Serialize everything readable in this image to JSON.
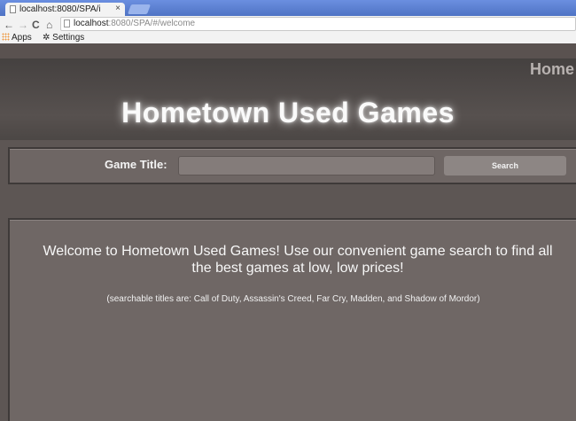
{
  "browser": {
    "tab_title": "localhost:8080/SPA/i",
    "tab_close": "×",
    "url_host": "localhost",
    "url_path": ":8080/SPA/#/welcome",
    "bookmarks": {
      "apps": "Apps",
      "settings_icon": "✲",
      "settings": "Settings"
    },
    "nav": {
      "back": "←",
      "forward": "→",
      "reload": "C",
      "home": "⌂"
    }
  },
  "page": {
    "home_link": "Home",
    "site_title": "Hometown Used Games",
    "search": {
      "label": "Game Title:",
      "value": "",
      "placeholder": "",
      "button_label": "Search"
    },
    "welcome_text": "Welcome to Hometown Used Games! Use our convenient game search to find all the best games at low, low prices!",
    "searchable_text": "(searchable titles are: Call of Duty, Assassin's Creed, Far Cry, Madden, and Shadow of Mordor)"
  }
}
